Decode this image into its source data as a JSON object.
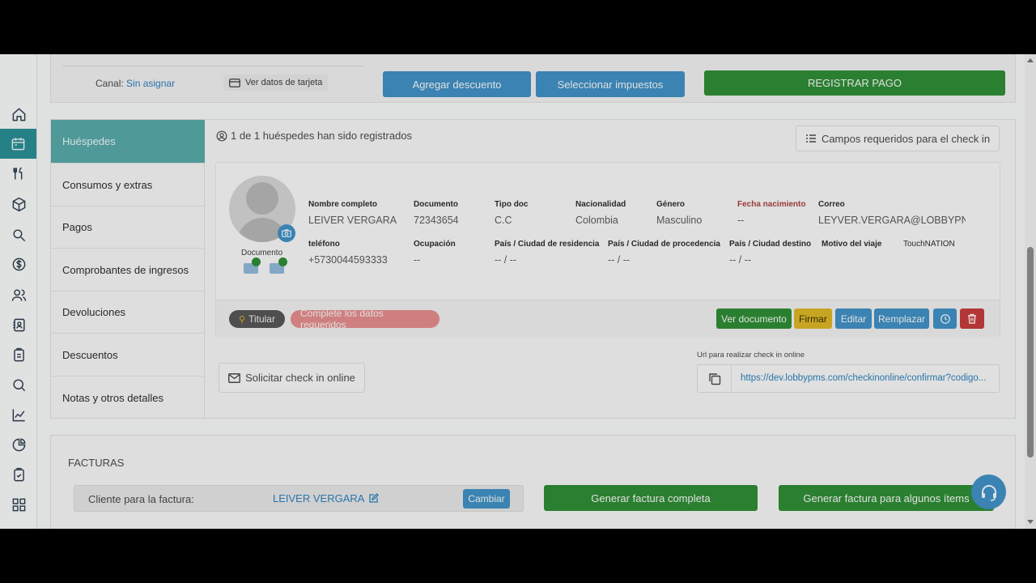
{
  "payment_bar": {
    "canal_label": "Canal:",
    "canal_value": "Sin asignar",
    "card_button": "Ver datos de tarjeta",
    "discount_button": "Agregar descuento",
    "tax_button": "Seleccionar impuestos",
    "pay_button": "REGISTRAR PAGO"
  },
  "tabs": [
    {
      "label": "Huéspedes"
    },
    {
      "label": "Consumos y extras"
    },
    {
      "label": "Pagos"
    },
    {
      "label": "Comprobantes de ingresos"
    },
    {
      "label": "Devoluciones"
    },
    {
      "label": "Descuentos"
    },
    {
      "label": "Notas y otros detalles"
    }
  ],
  "guests": {
    "registered_text": "1 de 1 huéspedes han sido registrados",
    "required_fields_button": "Campos requeridos para el check in",
    "document_label": "Documento",
    "fields": {
      "full_name": {
        "label": "Nombre completo",
        "value": "LEIVER VERGARA"
      },
      "document": {
        "label": "Documento",
        "value": "72343654"
      },
      "doc_type": {
        "label": "Tipo doc",
        "value": "C.C"
      },
      "nationality": {
        "label": "Nacionalidad",
        "value": "Colombia"
      },
      "gender": {
        "label": "Género",
        "value": "Masculino"
      },
      "birth_date": {
        "label": "Fecha nacimiento",
        "value": "--"
      },
      "email": {
        "label": "Correo",
        "value": "LEYVER.VERGARA@LOBBYPN"
      },
      "phone": {
        "label": "teléfono",
        "value": "+5730044593333"
      },
      "occupation": {
        "label": "Ocupación",
        "value": "--"
      },
      "residence": {
        "label": "País / Ciudad de residencia",
        "value": "-- / --"
      },
      "origin": {
        "label": "País / Ciudad de procedencia",
        "value": "-- / --"
      },
      "destination": {
        "label": "País / Ciudad destino",
        "value": "-- / --"
      },
      "trip_reason": {
        "label": "Motivo del viaje",
        "value": ""
      },
      "touchnation": {
        "label": "TouchNATION",
        "value": ""
      }
    },
    "titular_label": "Titular",
    "complete_label": "Complete los datos requeridos",
    "actions": {
      "view_document": "Ver documento",
      "sign": "Firmar",
      "edit": "Editar",
      "replace": "Remplazar"
    },
    "checkin_button": "Solicitar check in online",
    "url_label": "Url para realizar check in online",
    "url_value": "https://dev.lobbypms.com/checkinonline/confirmar?codigo..."
  },
  "invoices": {
    "title": "FACTURAS",
    "client_label": "Cliente para la factura:",
    "client_name": "LEIVER VERGARA",
    "change_button": "Cambiar",
    "full_invoice_button": "Generar factura completa",
    "partial_invoice_button": "Generar factura para algunos ítems"
  },
  "colors": {
    "primary_blue": "#3f8fc2",
    "success_green": "#2f8a35",
    "teal": "#2a8d93",
    "warning_yellow": "#d8b326",
    "danger_red": "#c23b3b"
  }
}
